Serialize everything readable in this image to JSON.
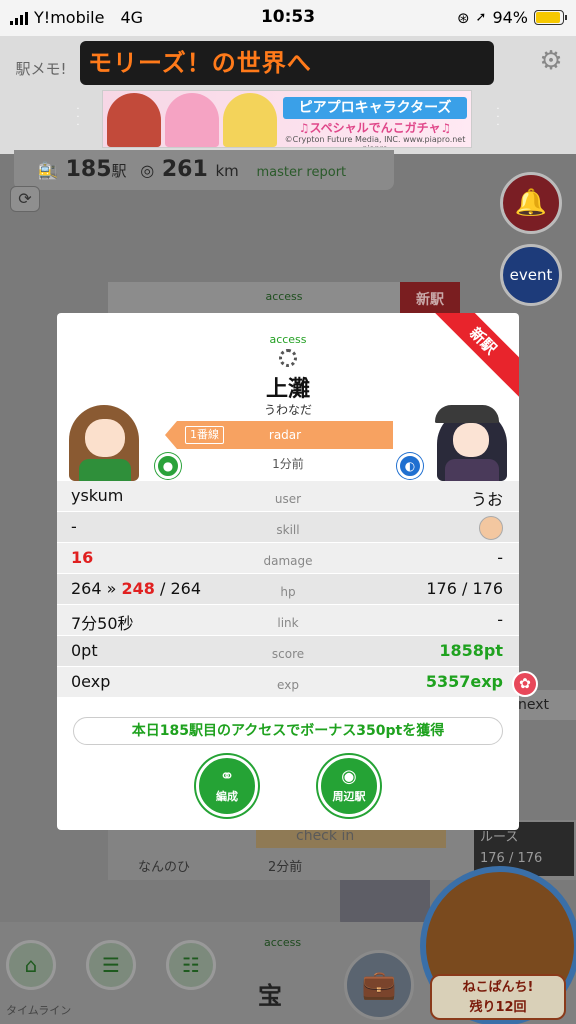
{
  "status_bar": {
    "carrier": "Y!mobile",
    "network": "4G",
    "time": "10:53",
    "battery": "94%",
    "battery_level": 0.94
  },
  "header": {
    "logo": "駅メモ!",
    "ticker": "モリーズ！の世界へ",
    "banner": {
      "title": "ピアプロキャラクターズ",
      "subtitle": "♫スペシャルでんこガチャ♫",
      "copyright": "©Crypton Future Media, INC.  www.piapro.net  piapro"
    }
  },
  "background": {
    "station_count": "185",
    "station_unit": "駅",
    "distance": "261",
    "distance_unit": "km",
    "master_report": "master report",
    "event_label": "event",
    "next_label": "next",
    "card_access": "access",
    "card_new": "新駅",
    "lower_left_name": "なんのひ",
    "lower_time": "2分前",
    "lower_checkin": "check in",
    "lower_right_name": "ルース",
    "lower_hp": "176 / 176",
    "bottom_access": "access",
    "bottom_station": "宝",
    "timeline_label": "タイムライン",
    "punch_label_1": "ねこぱんち!",
    "punch_label_2": "残り12回"
  },
  "modal": {
    "access": "access",
    "new_station": "新駅",
    "station": "上灘",
    "station_kana": "うわなだ",
    "line_badge": "1番線",
    "skill_name": "radar",
    "time_ago": "1分前",
    "rows": [
      {
        "left": "yskum",
        "center": "user",
        "right": "うお"
      },
      {
        "left": "-",
        "center": "skill",
        "right": ""
      },
      {
        "left": "16",
        "center": "damage",
        "right": "-"
      },
      {
        "left_pre": "264 » ",
        "left_hl": "248",
        "left_post": " / 264",
        "center": "hp",
        "right": "176 / 176"
      },
      {
        "left": "7分50秒",
        "center": "link",
        "right": "-"
      },
      {
        "left": "0pt",
        "center": "score",
        "right": "1858pt"
      },
      {
        "left": "0exp",
        "center": "exp",
        "right": "5357exp"
      }
    ],
    "bonus": "本日185駅目のアクセスでボーナス350ptを獲得",
    "btn_formation": "編成",
    "btn_nearby": "周辺駅"
  },
  "colors": {
    "accent_green": "#1fa21f",
    "damage_red": "#e02020",
    "ribbon_red": "#e8242c",
    "line_orange": "#f7a261",
    "ticker_orange": "#ff7a1a"
  }
}
